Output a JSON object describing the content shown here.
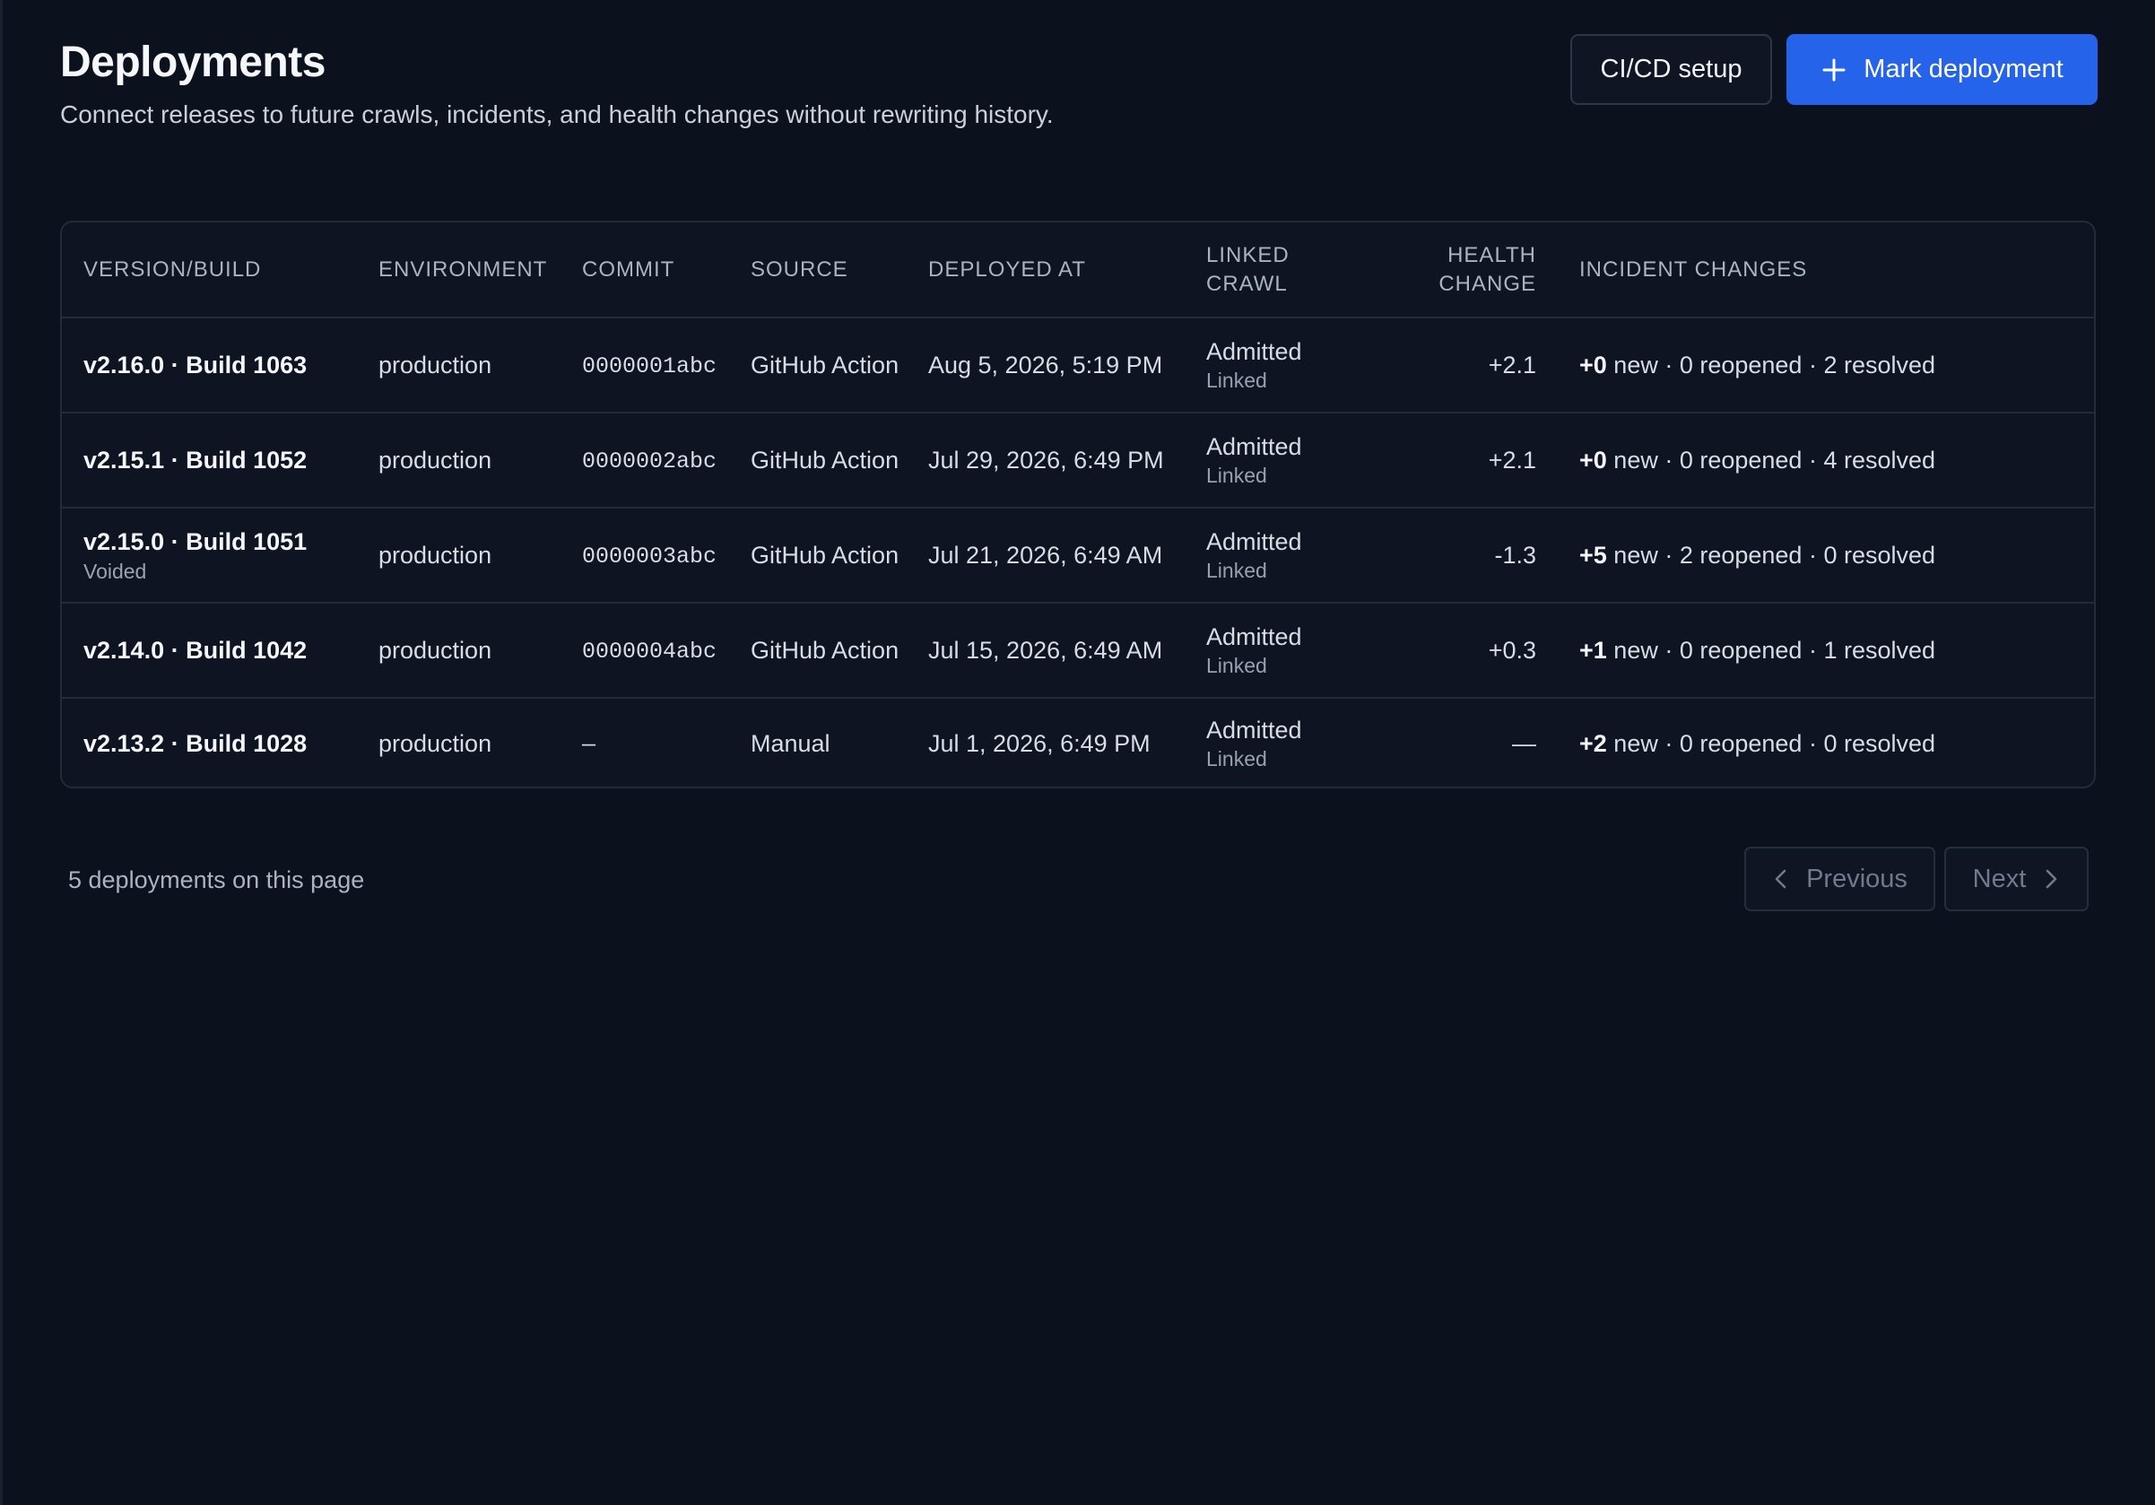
{
  "header": {
    "title": "Deployments",
    "subtitle": "Connect releases to future crawls, incidents, and health changes without rewriting history.",
    "cicd_label": "CI/CD setup",
    "mark_label": "Mark deployment"
  },
  "table": {
    "columns": [
      "VERSION/BUILD",
      "ENVIRONMENT",
      "COMMIT",
      "SOURCE",
      "DEPLOYED AT",
      "LINKED CRAWL",
      "HEALTH CHANGE",
      "INCIDENT CHANGES"
    ],
    "rows": [
      {
        "version": "v2.16.0 · Build 1063",
        "version_note": "",
        "environment": "production",
        "commit": "0000001abc",
        "source": "GitHub Action",
        "deployed_at": "Aug 5, 2026, 5:19 PM",
        "crawl_status": "Admitted",
        "crawl_link": "Linked",
        "health": "+2.1",
        "inc_new": "+0",
        "inc_rest": " new · 0 reopened · 2 resolved"
      },
      {
        "version": "v2.15.1 · Build 1052",
        "version_note": "",
        "environment": "production",
        "commit": "0000002abc",
        "source": "GitHub Action",
        "deployed_at": "Jul 29, 2026, 6:49 PM",
        "crawl_status": "Admitted",
        "crawl_link": "Linked",
        "health": "+2.1",
        "inc_new": "+0",
        "inc_rest": " new · 0 reopened · 4 resolved"
      },
      {
        "version": "v2.15.0 · Build 1051",
        "version_note": "Voided",
        "environment": "production",
        "commit": "0000003abc",
        "source": "GitHub Action",
        "deployed_at": "Jul 21, 2026, 6:49 AM",
        "crawl_status": "Admitted",
        "crawl_link": "Linked",
        "health": "-1.3",
        "inc_new": "+5",
        "inc_rest": " new · 2 reopened · 0 resolved"
      },
      {
        "version": "v2.14.0 · Build 1042",
        "version_note": "",
        "environment": "production",
        "commit": "0000004abc",
        "source": "GitHub Action",
        "deployed_at": "Jul 15, 2026, 6:49 AM",
        "crawl_status": "Admitted",
        "crawl_link": "Linked",
        "health": "+0.3",
        "inc_new": "+1",
        "inc_rest": " new · 0 reopened · 1 resolved"
      },
      {
        "version": "v2.13.2 · Build 1028",
        "version_note": "",
        "environment": "production",
        "commit": "—",
        "source": "Manual",
        "deployed_at": "Jul 1, 2026, 6:49 PM",
        "crawl_status": "Admitted",
        "crawl_link": "Linked",
        "health": "—",
        "inc_new": "+2",
        "inc_rest": " new · 0 reopened · 0 resolved"
      }
    ]
  },
  "footer": {
    "count_text": "5 deployments on this page",
    "previous_label": "Previous",
    "next_label": "Next"
  },
  "colors": {
    "background": "#0b111d",
    "primary": "#2563eb"
  },
  "icons": {
    "plus": "plus-icon",
    "previous": "chevron-left-icon",
    "next": "chevron-right-icon"
  }
}
